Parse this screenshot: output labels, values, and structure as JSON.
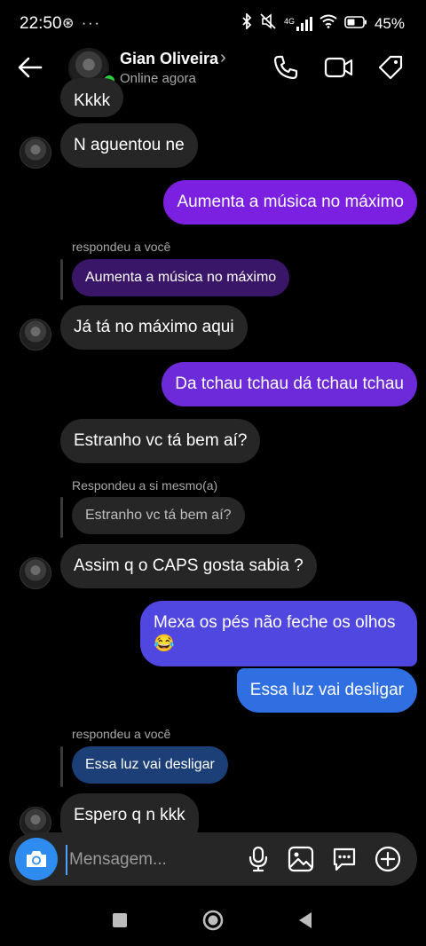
{
  "status_bar": {
    "time": "22:50",
    "extras": "⊛ ···",
    "net": "4G",
    "battery": "45%"
  },
  "header": {
    "name": "Gian Oliveira",
    "status": "Online agora",
    "chevron": "›"
  },
  "messages": {
    "m0": "Kkkk",
    "m1": "N aguentou ne",
    "m2": "Aumenta a música no máximo",
    "r1_label": "respondeu a você",
    "r1_quote": "Aumenta a música no máximo",
    "m3": "Já tá no máximo aqui",
    "m4": "Da tchau tchau dá tchau tchau",
    "m5": "Estranho vc tá bem aí?",
    "r2_label": "Respondeu a si mesmo(a)",
    "r2_quote": "Estranho vc tá bem aí?",
    "m6": "Assim q o CAPS gosta sabia ?",
    "m7_line1": "Mexa os pés não feche os olhos",
    "m7_line2": "😂",
    "m8": "Essa luz vai desligar",
    "r3_label": "respondeu a você",
    "r3_quote": "Essa luz vai desligar",
    "m9": "Espero q n kkk"
  },
  "composer": {
    "placeholder": "Mensagem..."
  },
  "colors": {
    "purple": "#7b1fe0",
    "violet": "#6c2ad9",
    "blue_violet": "#5046e0",
    "blue": "#2f6fe2",
    "reply_purple": "#3a1669",
    "reply_blue": "#1d3f77",
    "reply_gray": "#262626"
  },
  "icons": [
    "back-arrow-icon",
    "phone-icon",
    "video-icon",
    "tag-icon",
    "camera-icon",
    "microphone-icon",
    "gallery-icon",
    "sticker-icon",
    "plus-icon",
    "nav-square-icon",
    "nav-home-icon",
    "nav-back-icon"
  ]
}
